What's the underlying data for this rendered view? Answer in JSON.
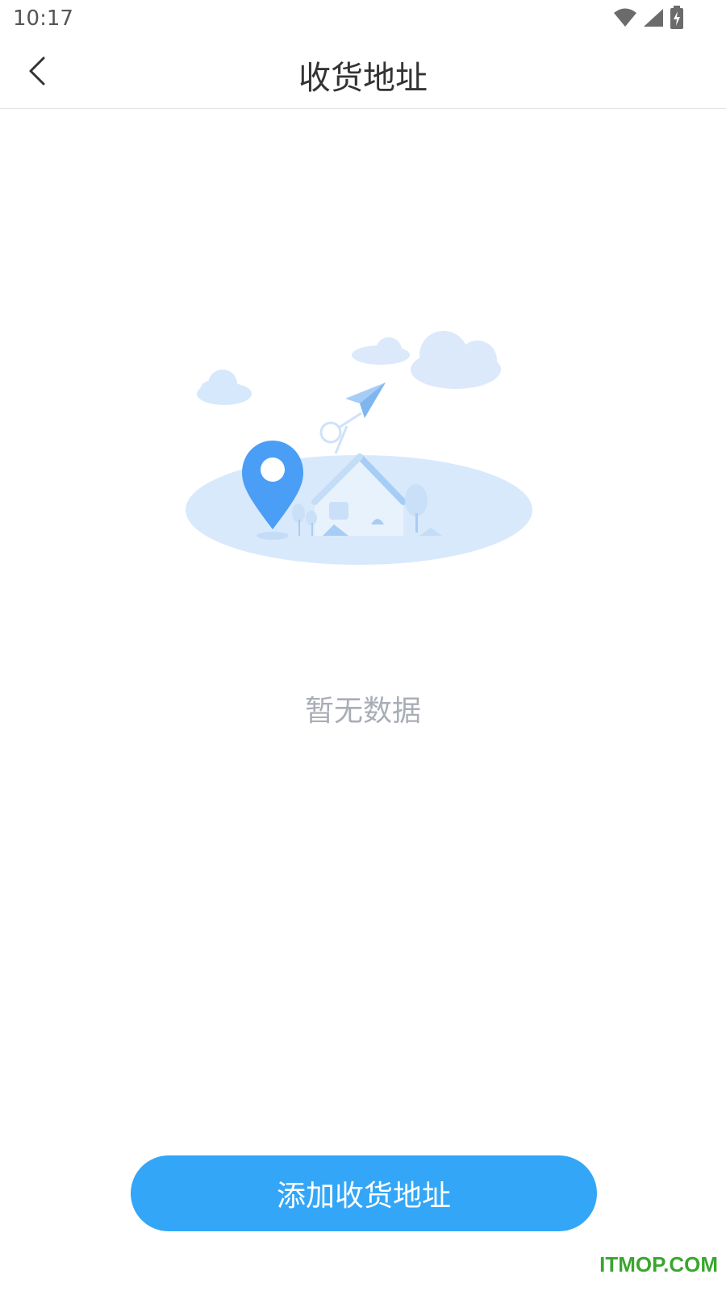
{
  "status_bar": {
    "time": "10:17",
    "icons": [
      "wifi-icon",
      "cellular-signal-icon",
      "battery-charging-icon"
    ]
  },
  "header": {
    "back_icon": "chevron-left-icon",
    "title": "收货地址"
  },
  "empty_state": {
    "illustration": "empty-address-illustration",
    "message": "暂无数据"
  },
  "actions": {
    "add_address_label": "添加收货地址"
  },
  "watermark": {
    "text": "ITMOP.COM"
  },
  "colors": {
    "primary": "#33a6f7",
    "pin": "#4a9ef5",
    "empty_text": "#a9adb6",
    "title_text": "#333333",
    "watermark": "#3aa62e"
  }
}
